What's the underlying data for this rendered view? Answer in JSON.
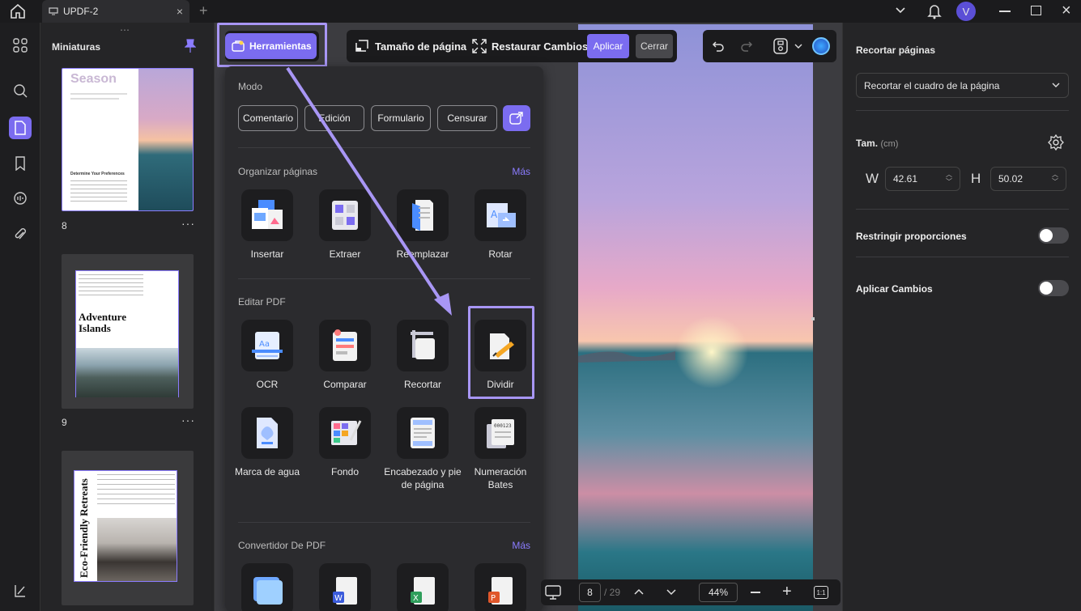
{
  "window": {
    "tab_title": "UPDF-2",
    "avatar_letter": "V"
  },
  "thumbnails": {
    "title": "Miniaturas",
    "pages": [
      {
        "num": "8",
        "heading": "Season",
        "subheading": "Determine Your Preferences"
      },
      {
        "num": "9",
        "heading": "Adventure Islands"
      },
      {
        "num": "",
        "heading": "Eco-Friendly Retreats"
      }
    ]
  },
  "tools_button": {
    "label": "Herramientas"
  },
  "crop_toolbar": {
    "page_size": "Tamaño de página",
    "restore": "Restaurar Cambios",
    "apply": "Aplicar",
    "close": "Cerrar"
  },
  "tools_panel": {
    "mode": {
      "title": "Modo",
      "items": [
        "Comentario",
        "Edición",
        "Formulario",
        "Censurar"
      ]
    },
    "organize": {
      "title": "Organizar páginas",
      "more": "Más",
      "items": [
        "Insertar",
        "Extraer",
        "Reemplazar",
        "Rotar"
      ]
    },
    "edit": {
      "title": "Editar PDF",
      "items": [
        "OCR",
        "Comparar",
        "Recortar",
        "Dividir"
      ],
      "items2": [
        "Marca de agua",
        "Fondo",
        "Encabezado y pie de página",
        "Numeración Bates"
      ]
    },
    "convert": {
      "title": "Convertidor De PDF",
      "more": "Más"
    }
  },
  "right_panel": {
    "title": "Recortar páginas",
    "dropdown": "Recortar el cuadro de la página",
    "size_label": "Tam.",
    "size_unit": "(cm)",
    "w_label": "W",
    "w_value": "42.61",
    "h_label": "H",
    "h_value": "50.02",
    "restrict": "Restringir proporciones",
    "apply_changes": "Aplicar Cambios"
  },
  "bottom": {
    "current_page": "8",
    "total": "/ 29",
    "zoom": "44%"
  },
  "colors": {
    "accent": "#8b7cff",
    "highlight": "#a896f5"
  }
}
